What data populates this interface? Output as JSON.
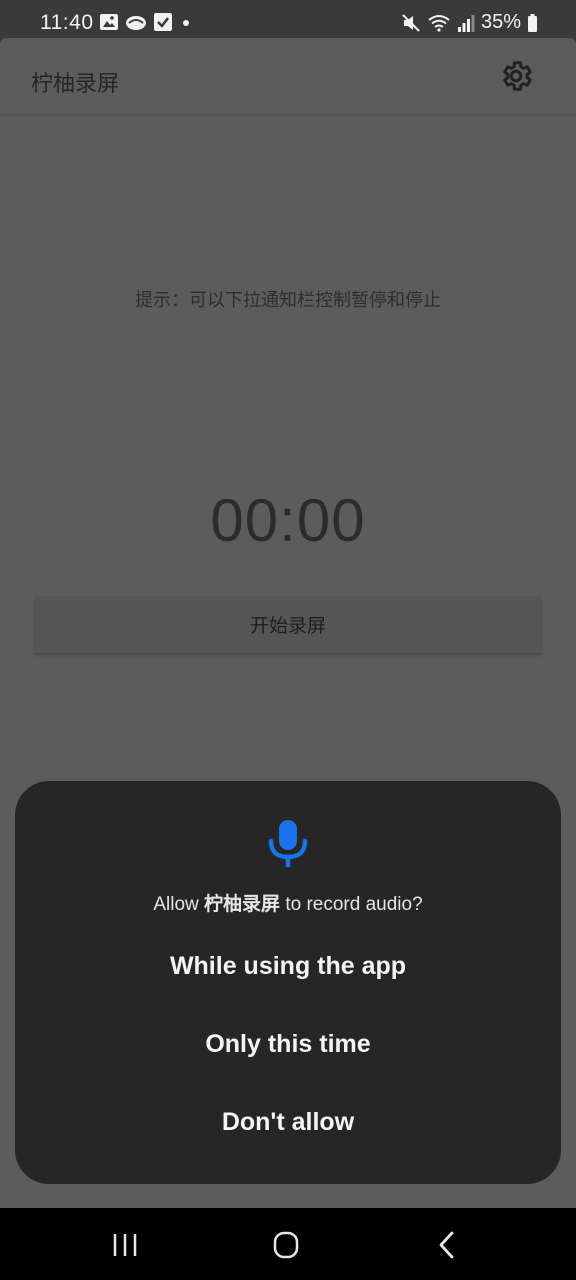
{
  "status_bar": {
    "time": "11:40",
    "battery": "35%",
    "icons": [
      "image-icon",
      "cloud-icon",
      "checkbox-icon",
      "dot-icon",
      "mute-icon",
      "wifi-icon",
      "signal-icon",
      "battery-icon"
    ]
  },
  "app_bar": {
    "title": "柠柚录屏",
    "settings_icon": "gear-icon"
  },
  "main": {
    "hint": "提示：可以下拉通知栏控制暂停和停止",
    "timer": "00:00",
    "start_button": "开始录屏"
  },
  "dialog": {
    "icon": "microphone-icon",
    "accent_color": "#1a73e8",
    "message_prefix": "Allow ",
    "app_name": "柠柚录屏",
    "message_suffix": " to record audio?",
    "options": {
      "while_using": "While using the app",
      "only_this_time": "Only this time",
      "dont_allow": "Don't allow"
    }
  },
  "nav_bar": {
    "icons": [
      "recent-apps-icon",
      "home-icon",
      "back-icon"
    ]
  }
}
